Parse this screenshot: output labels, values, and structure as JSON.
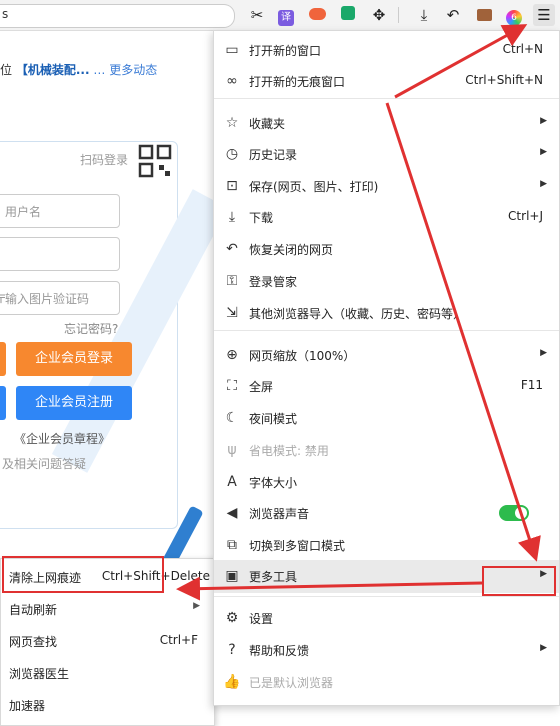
{
  "toolbar": {
    "address_fragment": "s",
    "icons": [
      "scissors-icon",
      "translate-icon",
      "game-icon",
      "reader-icon",
      "extensions-icon",
      "download-icon",
      "undo-icon",
      "briefcase-icon",
      "profile-icon",
      "menu-icon"
    ],
    "translate_glyph": "译",
    "profile_badge": "6"
  },
  "page": {
    "news_prefix": "位",
    "news_title": "【机械装配...",
    "news_more": "更多动态",
    "scan_login": "扫码登录",
    "username_placeholder": "用户名",
    "captcha_placeholder": "输入图片验证码",
    "forgot_password": "忘记密码?",
    "login_button": "企业会员登录",
    "register_button": "企业会员注册",
    "charter_link": "《企业会员章程》",
    "faq_text": "及相关问题答疑"
  },
  "menu": {
    "items": [
      {
        "label": "打开新的窗口",
        "shortcut": "Ctrl+N",
        "icon": "window-icon"
      },
      {
        "label": "打开新的无痕窗口",
        "shortcut": "Ctrl+Shift+N",
        "icon": "incognito-icon"
      },
      {
        "label": "收藏夹",
        "icon": "star-list-icon"
      },
      {
        "label": "历史记录",
        "icon": "clock-icon"
      },
      {
        "label": "保存(网页、图片、打印)",
        "icon": "save-icon"
      },
      {
        "label": "下载",
        "shortcut": "Ctrl+J",
        "icon": "download-icon"
      },
      {
        "label": "恢复关闭的网页",
        "icon": "restore-icon"
      },
      {
        "label": "登录管家",
        "icon": "key-icon"
      },
      {
        "label": "其他浏览器导入（收藏、历史、密码等）",
        "icon": "import-icon"
      },
      {
        "label": "网页缩放（100%）",
        "icon": "zoom-icon"
      },
      {
        "label": "全屏",
        "shortcut": "F11",
        "icon": "fullscreen-icon"
      },
      {
        "label": "夜间模式",
        "icon": "moon-icon"
      },
      {
        "label": "省电模式: 禁用",
        "icon": "power-saving-icon"
      },
      {
        "label": "字体大小",
        "icon": "font-size-icon"
      },
      {
        "label": "浏览器声音",
        "icon": "speaker-icon"
      },
      {
        "label": "切换到多窗口模式",
        "icon": "multi-window-icon"
      },
      {
        "label": "更多工具",
        "icon": "toolbox-icon"
      },
      {
        "label": "设置",
        "icon": "gear-icon"
      },
      {
        "label": "帮助和反馈",
        "icon": "help-icon"
      },
      {
        "label": "已是默认浏览器",
        "icon": "thumbs-up-icon"
      }
    ],
    "sound_toggle_on": true
  },
  "submenu": {
    "items": [
      {
        "label": "清除上网痕迹",
        "shortcut": "Ctrl+Shift+Delete"
      },
      {
        "label": "自动刷新"
      },
      {
        "label": "网页查找",
        "shortcut": "Ctrl+F"
      },
      {
        "label": "浏览器医生"
      },
      {
        "label": "加速器"
      }
    ]
  },
  "colors": {
    "annotation_red": "#e03131",
    "login_orange": "#f7882f",
    "register_blue": "#2f86f6",
    "toggle_green": "#2dbb4d",
    "link_blue": "#1a5fb4"
  }
}
